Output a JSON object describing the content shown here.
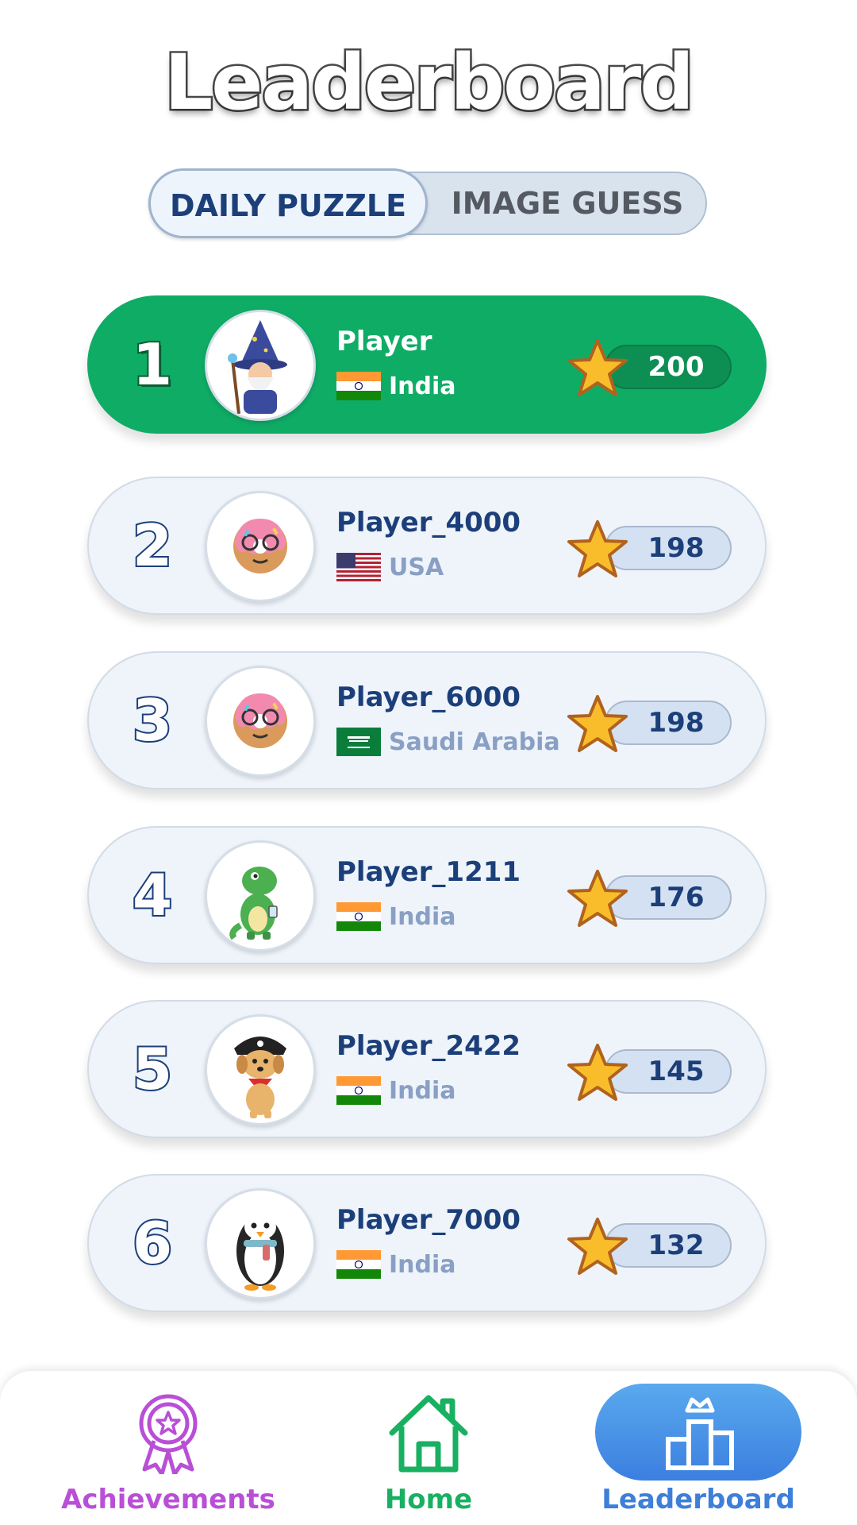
{
  "header": {
    "title": "Leaderboard"
  },
  "tabs": [
    {
      "label": "DAILY PUZZLE",
      "active": true
    },
    {
      "label": "IMAGE GUESS",
      "active": false
    }
  ],
  "leaderboard": [
    {
      "rank": "1",
      "name": "Player",
      "country": "India",
      "score": "200",
      "avatar": "wizard-avatar",
      "flag": "india-flag"
    },
    {
      "rank": "2",
      "name": "Player_4000",
      "country": "USA",
      "score": "198",
      "avatar": "donut-avatar",
      "flag": "usa-flag"
    },
    {
      "rank": "3",
      "name": "Player_6000",
      "country": "Saudi Arabia",
      "score": "198",
      "avatar": "donut-avatar",
      "flag": "saudi-arabia-flag"
    },
    {
      "rank": "4",
      "name": "Player_1211",
      "country": "India",
      "score": "176",
      "avatar": "dinosaur-avatar",
      "flag": "india-flag"
    },
    {
      "rank": "5",
      "name": "Player_2422",
      "country": "India",
      "score": "145",
      "avatar": "pirate-dog-avatar",
      "flag": "india-flag"
    },
    {
      "rank": "6",
      "name": "Player_7000",
      "country": "India",
      "score": "132",
      "avatar": "penguin-avatar",
      "flag": "india-flag"
    }
  ],
  "bottom_nav": [
    {
      "label": "Achievements",
      "icon": "medal-icon",
      "color": "#b94fd6"
    },
    {
      "label": "Home",
      "icon": "home-icon",
      "color": "#18b061"
    },
    {
      "label": "Leaderboard",
      "icon": "podium-icon",
      "color": "#3d7fd9",
      "active": true
    }
  ],
  "colors": {
    "first_place": "#0fac66",
    "row_background": "#eef4fa",
    "navy_text": "#1c3f7a",
    "star": "#f9bd2c"
  }
}
